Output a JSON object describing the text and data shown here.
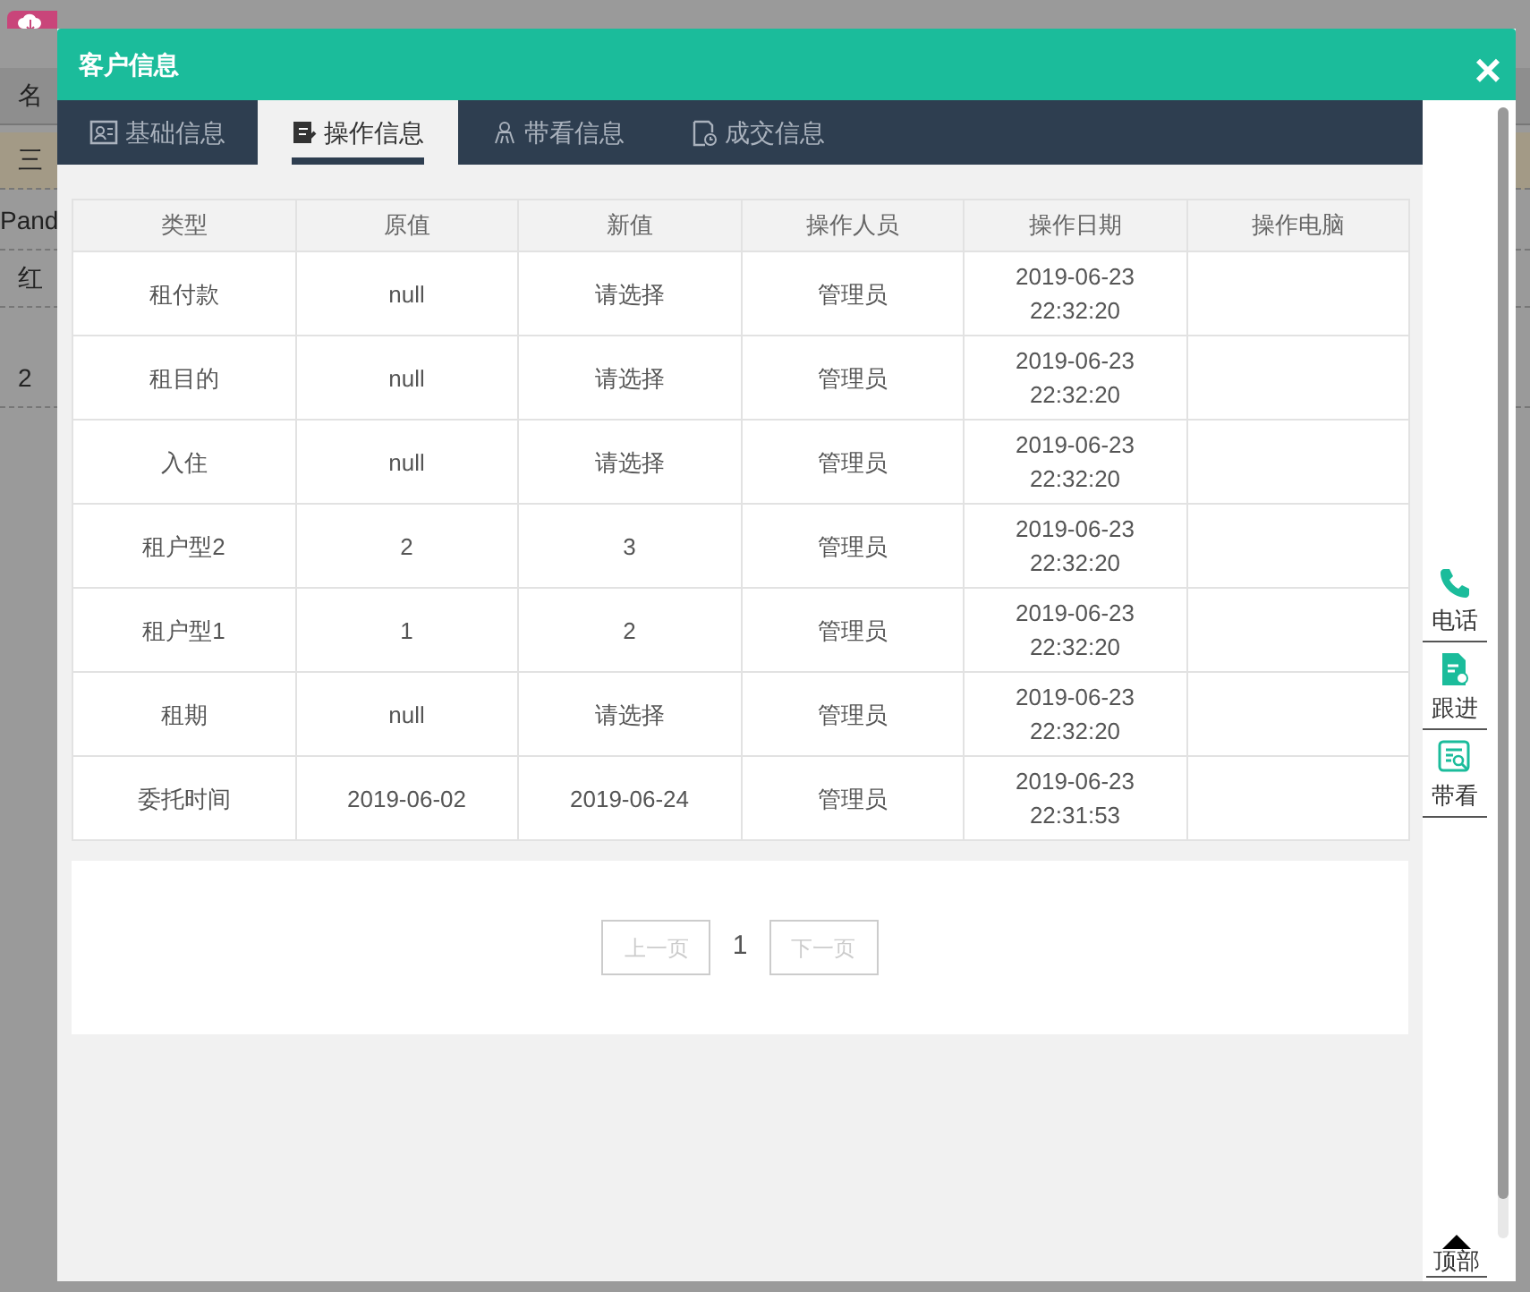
{
  "background_page": {
    "column_header": "名",
    "rows": [
      "三",
      "Pand",
      "红",
      "2"
    ]
  },
  "dialog": {
    "title": "客户信息",
    "close": "×"
  },
  "tabs": [
    {
      "label": "基础信息",
      "selected": false
    },
    {
      "label": "操作信息",
      "selected": true
    },
    {
      "label": "带看信息",
      "selected": false
    },
    {
      "label": "成交信息",
      "selected": false
    }
  ],
  "table": {
    "columns": [
      "类型",
      "原值",
      "新值",
      "操作人员",
      "操作日期",
      "操作电脑"
    ],
    "rows": [
      [
        "租付款",
        "null",
        "请选择",
        "管理员",
        "2019-06-23\n22:32:20"
      ],
      [
        "租目的",
        "null",
        "请选择",
        "管理员",
        "2019-06-23\n22:32:20"
      ],
      [
        "入住",
        "null",
        "请选择",
        "管理员",
        "2019-06-23\n22:32:20"
      ],
      [
        "租户型2",
        "2",
        "3",
        "管理员",
        "2019-06-23\n22:32:20"
      ],
      [
        "租户型1",
        "1",
        "2",
        "管理员",
        "2019-06-23\n22:32:20"
      ],
      [
        "租期",
        "null",
        "请选择",
        "管理员",
        "2019-06-23\n22:32:20"
      ],
      [
        "委托时间",
        "2019-06-02",
        "2019-06-24",
        "管理员",
        "2019-06-23\n22:31:53"
      ]
    ]
  },
  "pagination": {
    "prev": "上一页",
    "page": "1",
    "next": "下一页"
  },
  "side_tools": [
    {
      "label": "电话"
    },
    {
      "label": "跟进"
    },
    {
      "label": "带看"
    }
  ],
  "top_button": "顶部"
}
